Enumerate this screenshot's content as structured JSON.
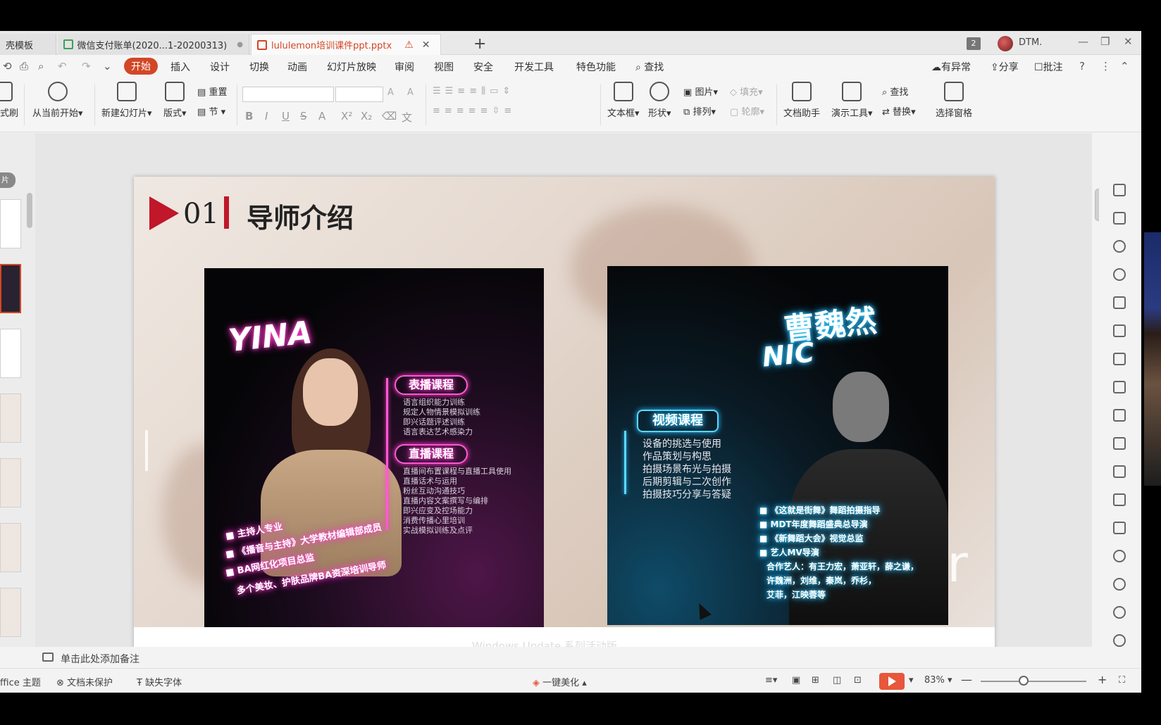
{
  "tabs": [
    {
      "label": "壳模板"
    },
    {
      "label": "微信支付账单(2020...1-20200313)"
    },
    {
      "label": "lululemon培训课件ppt.pptx"
    }
  ],
  "window": {
    "count": "2",
    "user": "DTM."
  },
  "menu": {
    "items": [
      "开始",
      "插入",
      "设计",
      "切换",
      "动画",
      "幻灯片放映",
      "审阅",
      "视图",
      "安全",
      "开发工具",
      "特色功能"
    ],
    "search": "查找",
    "right": [
      "有异常",
      "分享",
      "批注"
    ]
  },
  "ribbon": {
    "format_brush": "式刷",
    "play_from_current": "从当前开始",
    "new_slide": "新建幻灯片",
    "layout": "版式",
    "reset": "重置",
    "section": "节",
    "textbox": "文本框",
    "shape": "形状",
    "picture": "图片",
    "arrange": "排列",
    "fill": "填充",
    "outline": "轮廓",
    "doc_assistant": "文档助手",
    "presentation_tools": "演示工具",
    "find": "查找",
    "replace": "替换",
    "select_pane": "选择窗格"
  },
  "thumbs_tag": "片",
  "slide": {
    "num": "01",
    "title": "导师介绍",
    "bg_text": "er",
    "bottom_faint": "Windows Update 系列活动版",
    "left": {
      "name": "YINA",
      "course1": "表播课程",
      "course1_items": [
        "语言组织能力训练",
        "规定人物情景模拟训练",
        "即兴话题评述训练",
        "语言表达艺术感染力"
      ],
      "course2": "直播课程",
      "course2_items": [
        "直播间布置课程与直播工具使用",
        "直播话术与运用",
        "粉丝互动沟通技巧",
        "直播内容文案撰写与编排",
        "即兴应变及控场能力",
        "消费传播心里培训",
        "实战模拟训练及点评"
      ],
      "tags": [
        "主持人专业",
        "《播音与主持》大学教材编辑部成员",
        "BA网红化项目总监",
        "多个美妆、护肤品牌BA资深培训导师"
      ]
    },
    "right": {
      "name_cn": "曹魏然",
      "name_en": "NIC",
      "course": "视频课程",
      "items": [
        "设备的挑选与使用",
        "作品策划与构思",
        "拍摄场景布光与拍摄",
        "后期剪辑与二次创作",
        "拍摄技巧分享与答疑"
      ],
      "credits": [
        "《这就是街舞》舞蹈拍摄指导",
        "MDT年度舞蹈盛典总导演",
        "《新舞蹈大会》视觉总监",
        "艺人MV导演",
        "合作艺人：有王力宏，萧亚轩，薛之谦，",
        "许魏洲，刘维，秦岚，乔杉，",
        "艾菲，江映蓉等"
      ]
    }
  },
  "notes": "单击此处添加备注",
  "status": {
    "theme": "ffice 主题",
    "protect": "文档未保护",
    "missing_font": "缺失字体",
    "beautify": "一键美化",
    "zoom": "83%"
  },
  "colors": {
    "accent": "#d24726",
    "title_red": "#c0172a",
    "neon_pink": "#ff4ad8",
    "neon_blue": "#3fd6ff"
  }
}
